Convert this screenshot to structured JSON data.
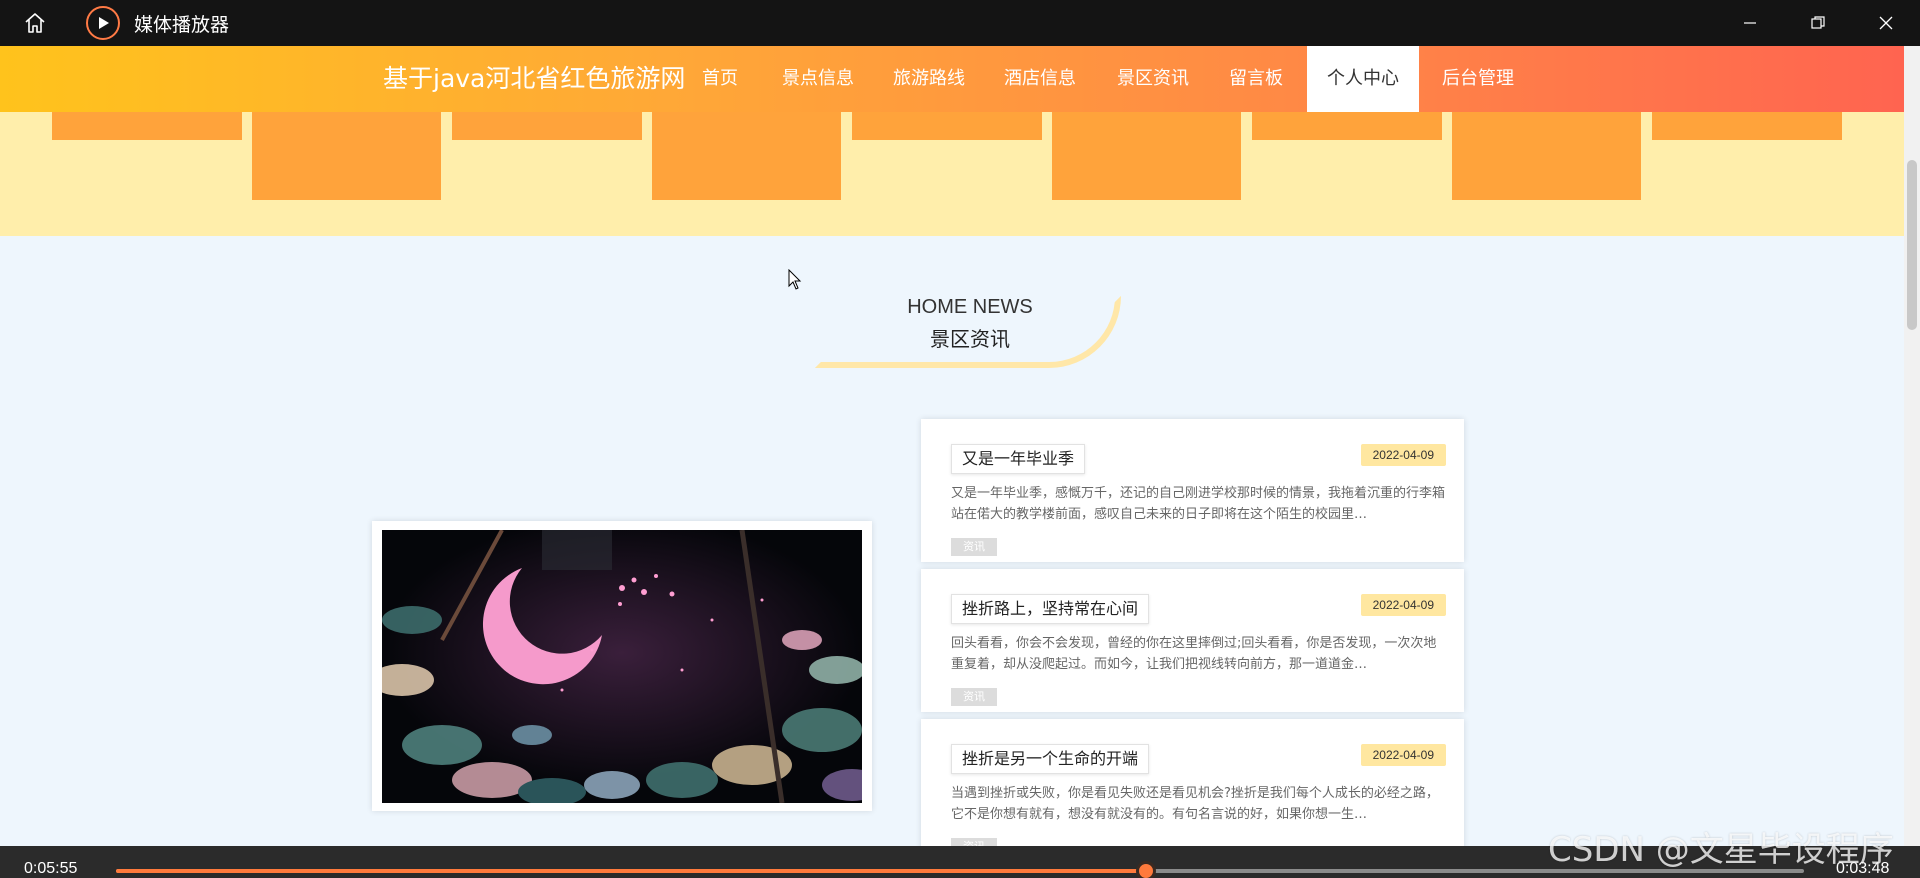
{
  "window": {
    "title": "媒体播放器"
  },
  "site": {
    "brand": "基于java河北省红色旅游网",
    "nav": [
      {
        "label": "首页"
      },
      {
        "label": "景点信息"
      },
      {
        "label": "旅游路线"
      },
      {
        "label": "酒店信息"
      },
      {
        "label": "景区资讯"
      },
      {
        "label": "留言板"
      },
      {
        "label": "个人中心",
        "active": true
      },
      {
        "label": "后台管理"
      }
    ]
  },
  "section": {
    "title_en": "HOME NEWS",
    "title_cn": "景区资讯"
  },
  "news": [
    {
      "title": "又是一年毕业季",
      "date": "2022-04-09",
      "summary": "又是一年毕业季，感慨万千，还记的自己刚进学校那时候的情景，我拖着沉重的行李箱站在偌大的教学楼前面，感叹自己未来的日子即将在这个陌生的校园里…",
      "tag": "资讯"
    },
    {
      "title": "挫折路上，坚持常在心间",
      "date": "2022-04-09",
      "summary": "回头看看，你会不会发现，曾经的你在这里摔倒过;回头看看，你是否发现，一次次地重复着，却从没爬起过。而如今，让我们把视线转向前方，那一道道金…",
      "tag": "资讯"
    },
    {
      "title": "挫折是另一个生命的开端",
      "date": "2022-04-09",
      "summary": "当遇到挫折或失败，你是看见失败还是看见机会?挫折是我们每个人成长的必经之路，它不是你想有就有，想没有就没有的。有句名言说的好，如果你想一生…",
      "tag": "资讯"
    }
  ],
  "player": {
    "elapsed": "0:05:55",
    "remaining": "0:03:48",
    "progress": 0.61
  },
  "watermark": "CSDN @文星毕设程序",
  "colors": {
    "accent": "#ff7a3c",
    "nav_start": "#ffc31c",
    "nav_end": "#ff6450",
    "band": "#ffeeab",
    "block": "#ffa33b",
    "date_badge": "#ffe7a0"
  }
}
